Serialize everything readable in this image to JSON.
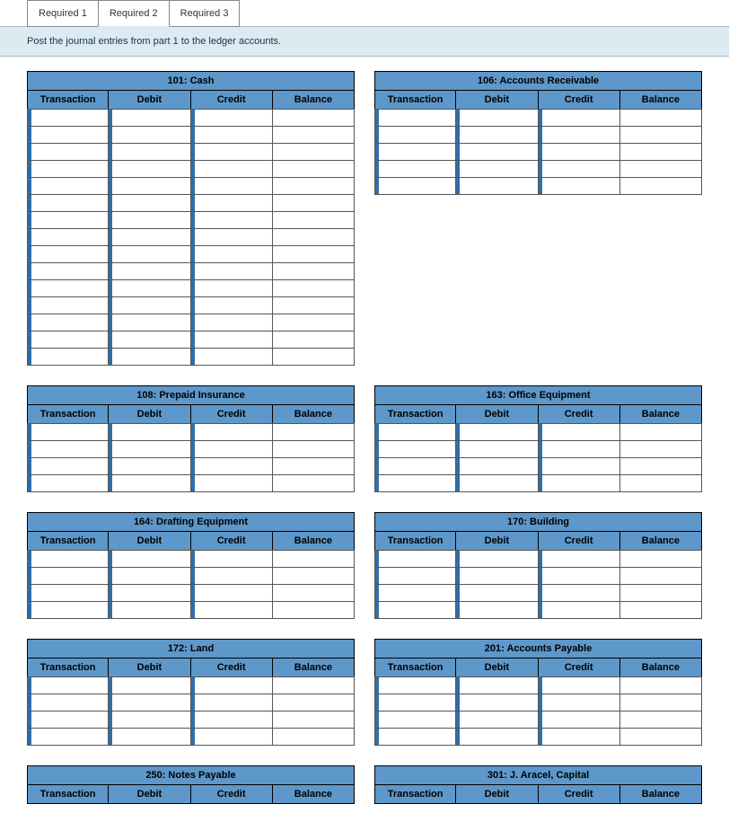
{
  "tabs": [
    {
      "label": "Required 1",
      "active": false
    },
    {
      "label": "Required 2",
      "active": true
    },
    {
      "label": "Required 3",
      "active": false
    }
  ],
  "instruction": "Post the journal entries from part 1 to the ledger accounts.",
  "columns": {
    "transaction": "Transaction",
    "debit": "Debit",
    "credit": "Credit",
    "balance": "Balance"
  },
  "pairs": [
    {
      "left": {
        "title": "101: Cash",
        "rows": 15
      },
      "right": {
        "title": "106: Accounts Receivable",
        "rows": 5
      }
    },
    {
      "left": {
        "title": "108: Prepaid Insurance",
        "rows": 4
      },
      "right": {
        "title": "163: Office Equipment",
        "rows": 4
      }
    },
    {
      "left": {
        "title": "164: Drafting Equipment",
        "rows": 4
      },
      "right": {
        "title": "170: Building",
        "rows": 4
      }
    },
    {
      "left": {
        "title": "172: Land",
        "rows": 4
      },
      "right": {
        "title": "201: Accounts Payable",
        "rows": 4
      }
    },
    {
      "left": {
        "title": "250: Notes Payable",
        "rows": 0
      },
      "right": {
        "title": "301: J. Aracel, Capital",
        "rows": 0
      }
    }
  ]
}
